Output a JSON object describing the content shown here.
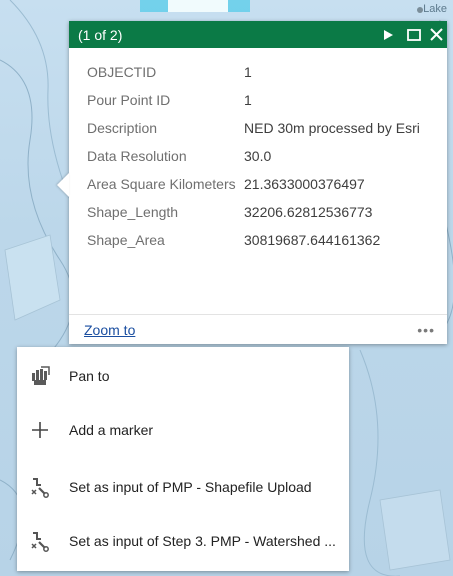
{
  "map": {
    "corner_label": "Lake"
  },
  "popup": {
    "counter": "(1 of 2)",
    "header_color": "#0b7a46",
    "next_icon": "play-next-icon",
    "maximize_icon": "maximize-icon",
    "close_icon": "close-icon",
    "fields": [
      {
        "key": "OBJECTID",
        "value": "1"
      },
      {
        "key": "Pour Point ID",
        "value": "1"
      },
      {
        "key": "Description",
        "value": "NED 30m processed by Esri"
      },
      {
        "key": "Data Resolution",
        "value": "30.0"
      },
      {
        "key": "Area Square Kilometers",
        "value": "21.3633000376497"
      },
      {
        "key": "Shape_Length",
        "value": "32206.62812536773"
      },
      {
        "key": "Shape_Area",
        "value": "30819687.644161362"
      }
    ],
    "zoom_link": "Zoom to",
    "more": "•••"
  },
  "actions": [
    {
      "icon": "pan-hand-icon",
      "label": "Pan to"
    },
    {
      "icon": "plus-icon",
      "label": "Add a marker"
    },
    {
      "icon": "geoprocessing-icon",
      "label": "Set as input of PMP - Shapefile Upload"
    },
    {
      "icon": "geoprocessing-icon",
      "label": "Set as input of Step 3. PMP - Watershed ..."
    }
  ]
}
